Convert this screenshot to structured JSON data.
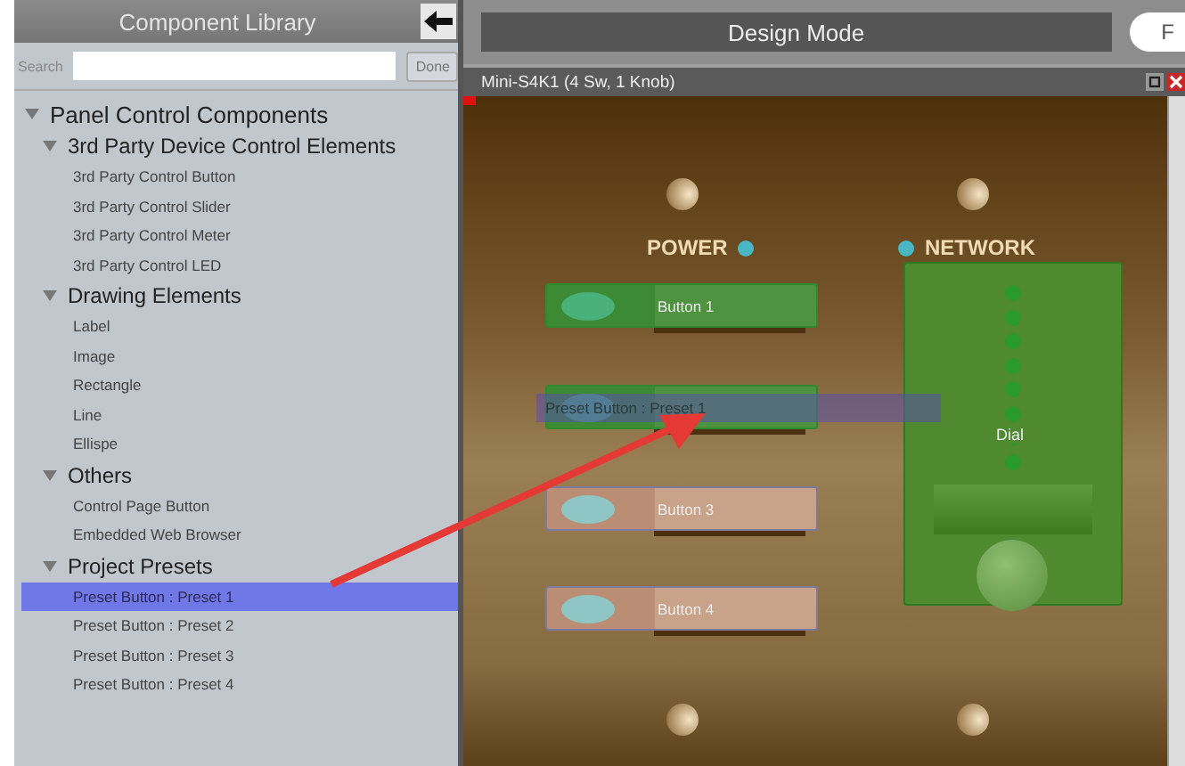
{
  "library": {
    "title": "Component Library",
    "search_label": "Search",
    "done_button": "Done",
    "tree": [
      {
        "label": "Panel Control Components",
        "expanded": true,
        "children": [
          {
            "label": "3rd Party Device Control Elements",
            "expanded": true,
            "children": [
              {
                "label": "3rd Party Control Button",
                "selected": false
              },
              {
                "label": "3rd Party Control Slider",
                "selected": false
              },
              {
                "label": "3rd Party Control Meter",
                "selected": false
              },
              {
                "label": "3rd Party Control LED",
                "selected": false
              }
            ]
          },
          {
            "label": "Drawing Elements",
            "expanded": true,
            "children": [
              {
                "label": "Label",
                "selected": false
              },
              {
                "label": "Image",
                "selected": false
              },
              {
                "label": "Rectangle",
                "selected": false
              },
              {
                "label": "Line",
                "selected": false
              },
              {
                "label": "Ellispe",
                "selected": false
              }
            ]
          },
          {
            "label": "Others",
            "expanded": true,
            "children": [
              {
                "label": "Control Page Button",
                "selected": false
              },
              {
                "label": "Embedded Web Browser",
                "selected": false
              }
            ]
          },
          {
            "label": "Project Presets",
            "expanded": true,
            "children": [
              {
                "label": "Preset Button : Preset 1",
                "selected": true
              },
              {
                "label": "Preset Button : Preset 2",
                "selected": false
              },
              {
                "label": "Preset Button : Preset 3",
                "selected": false
              },
              {
                "label": "Preset Button : Preset 4",
                "selected": false
              }
            ]
          }
        ]
      }
    ]
  },
  "design": {
    "mode_title": "Design Mode",
    "side_tab": "F",
    "panel": {
      "title": "Mini-S4K1 (4 Sw, 1 Knob)",
      "labels": [
        {
          "text": "POWER"
        },
        {
          "text": "NETWORK"
        }
      ],
      "buttons": [
        {
          "label": "Button 1",
          "on": true
        },
        {
          "on": true
        },
        {
          "label": "Button 3",
          "on": false
        },
        {
          "label": "Button 4",
          "on": false
        }
      ],
      "dial": {
        "label": "Dial"
      },
      "drag_ghost": "Preset Button : Preset 1"
    }
  }
}
